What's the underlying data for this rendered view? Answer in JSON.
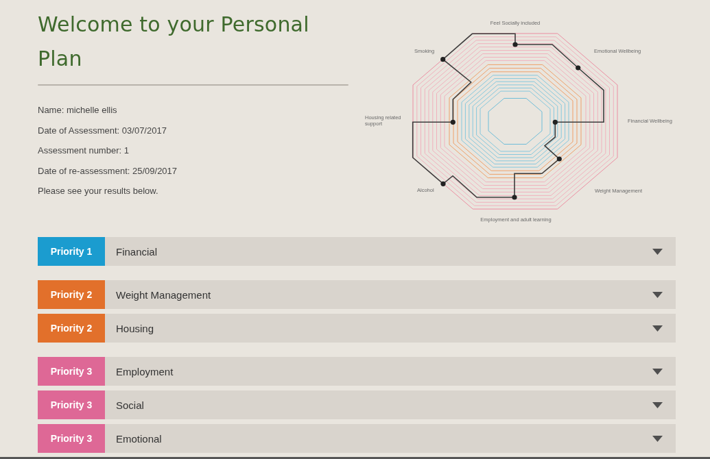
{
  "header": {
    "title": "Welcome to your Personal Plan"
  },
  "details": [
    "Name: michelle ellis",
    "Date of Assessment: 03/07/2017",
    "Assessment number: 1",
    "Date of re-assessment: 25/09/2017"
  ],
  "note": "Please see your results below.",
  "wellbeing_chart": {
    "axis_labels": [
      "Feel Socially included",
      "Emotional Wellbeing",
      "Financial Wellbeing",
      "Weight Management",
      "Employment and adult learning",
      "Alcohol",
      "Housing related support",
      "Smoking"
    ]
  },
  "priority_groups": [
    {
      "rows": [
        {
          "badge": "Priority 1",
          "color": "#1b9ccf",
          "title": "Financial"
        }
      ]
    },
    {
      "rows": [
        {
          "badge": "Priority 2",
          "color": "#e2702b",
          "title": "Weight Management"
        },
        {
          "badge": "Priority 2",
          "color": "#e2702b",
          "title": "Housing"
        }
      ]
    },
    {
      "rows": [
        {
          "badge": "Priority 3",
          "color": "#de6896",
          "title": "Employment"
        },
        {
          "badge": "Priority 3",
          "color": "#de6896",
          "title": "Social"
        },
        {
          "badge": "Priority 3",
          "color": "#de6896",
          "title": "Emotional"
        }
      ]
    }
  ]
}
